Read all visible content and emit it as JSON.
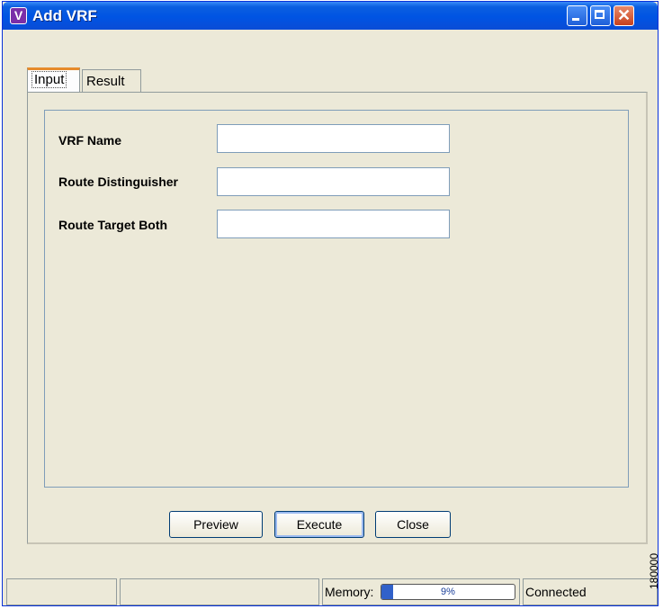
{
  "window": {
    "title": "Add VRF",
    "app_icon_letter": "V"
  },
  "title_buttons": {
    "minimize": "minimize-icon",
    "maximize": "maximize-icon",
    "close": "close-icon"
  },
  "tabs": [
    {
      "label": "Input",
      "active": true
    },
    {
      "label": "Result",
      "active": false
    }
  ],
  "form": {
    "fields": [
      {
        "label": "VRF Name",
        "value": ""
      },
      {
        "label": "Route Distinguisher",
        "value": ""
      },
      {
        "label": "Route Target Both",
        "value": ""
      }
    ]
  },
  "buttons": {
    "preview": "Preview",
    "execute": "Execute",
    "close": "Close"
  },
  "statusbar": {
    "memory_label": "Memory:",
    "memory_percent_text": "9%",
    "memory_fraction": 0.09,
    "connection": "Connected"
  },
  "side_label": "180000",
  "colors": {
    "titlebar": "#0054e3",
    "memory_fill": "#3161c9",
    "active_tab_accent": "#e68b2c"
  }
}
